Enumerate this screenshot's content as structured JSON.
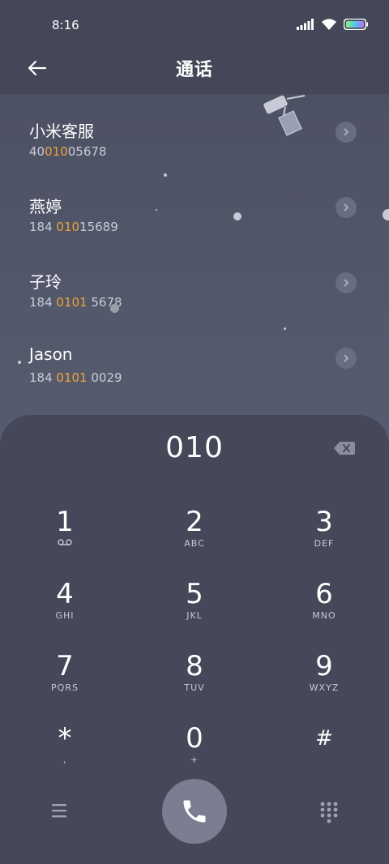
{
  "status": {
    "time": "8:16"
  },
  "header": {
    "title": "通话"
  },
  "results": [
    {
      "name": "小米客服",
      "number_pre": "40",
      "number_hl": "010",
      "number_post": "05678"
    },
    {
      "name": "燕婷",
      "number_pre": "184 ",
      "number_hl": "010",
      "number_post": "15689"
    },
    {
      "name": "子玲",
      "number_pre": "184 ",
      "number_hl": "0101",
      "number_post": " 5678"
    },
    {
      "name": "Jason",
      "number_pre": "184 ",
      "number_hl": "0101",
      "number_post": " 0029"
    }
  ],
  "dialpad": {
    "input": "010",
    "keys": [
      {
        "num": "1",
        "sub": "voicemail-icon"
      },
      {
        "num": "2",
        "sub": "ABC"
      },
      {
        "num": "3",
        "sub": "DEF"
      },
      {
        "num": "4",
        "sub": "GHI"
      },
      {
        "num": "5",
        "sub": "JKL"
      },
      {
        "num": "6",
        "sub": "MNO"
      },
      {
        "num": "7",
        "sub": "PQRS"
      },
      {
        "num": "8",
        "sub": "TUV"
      },
      {
        "num": "9",
        "sub": "WXYZ"
      },
      {
        "num": "*",
        "sub": ","
      },
      {
        "num": "0",
        "sub": "+"
      },
      {
        "num": "#",
        "sub": ""
      }
    ]
  },
  "colors": {
    "highlight": "#f0a23b",
    "panel": "#454858",
    "call_button": "#7a7e90"
  }
}
